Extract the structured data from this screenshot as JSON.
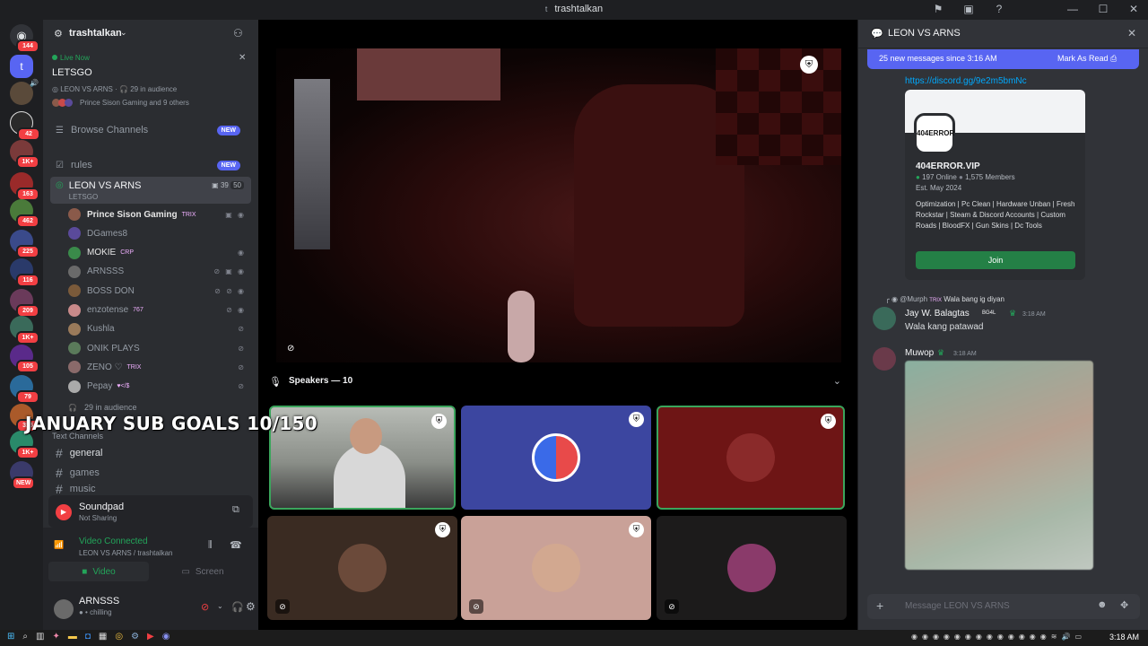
{
  "window": {
    "title": "trashtalkan",
    "title_icon": "t"
  },
  "server_rail": {
    "badges": [
      "144",
      "42",
      "1K+",
      "163",
      "462",
      "225",
      "116",
      "209",
      "1K+",
      "105",
      "79",
      "315",
      "1K+",
      "NEW"
    ]
  },
  "server": {
    "name": "trashtalkan",
    "live": {
      "status": "Live Now",
      "event_name": "LETSGO",
      "channel": "LEON VS ARNS",
      "audience": "29 in audience",
      "attendees": "Prince Sison Gaming and 9 others"
    },
    "browse_channels": "Browse Channels",
    "new_label": "NEW",
    "rules": "rules",
    "voice_channel": {
      "name": "LEON VS ARNS",
      "sub": "LETSGO",
      "count_a": "39",
      "count_b": "50"
    },
    "members": [
      {
        "name": "Prince Sison Gaming",
        "tag": "TRIX",
        "icons": "▣ ◉",
        "color": "#e6e6e6",
        "bold": true,
        "avatar": "#8a5a4a"
      },
      {
        "name": "DGames8",
        "tag": "",
        "icons": "",
        "color": "#949ba4",
        "bold": false,
        "avatar": "#5a4a9a"
      },
      {
        "name": "MOKIE",
        "tag": "CRP",
        "icons": "◉",
        "color": "#e6e6e6",
        "bold": false,
        "avatar": "#3a8a4a"
      },
      {
        "name": "ARNSSS",
        "tag": "",
        "icons": "⊘ ▣ ◉",
        "color": "#949ba4",
        "bold": false,
        "avatar": "#6a6a6a"
      },
      {
        "name": "BOSS DON",
        "tag": "",
        "icons": "⊘ ⊘ ◉",
        "color": "#949ba4",
        "bold": false,
        "avatar": "#7a5a3a"
      },
      {
        "name": "enzotense",
        "tag": "767",
        "icons": "⊘ ◉",
        "color": "#949ba4",
        "bold": false,
        "avatar": "#c98a8a"
      },
      {
        "name": "Kushla",
        "tag": "",
        "icons": "⊘",
        "color": "#949ba4",
        "bold": false,
        "avatar": "#9a7a5a"
      },
      {
        "name": "ONIK PLAYS",
        "tag": "",
        "icons": "⊘",
        "color": "#949ba4",
        "bold": false,
        "avatar": "#5a7a5a"
      },
      {
        "name": "ZENO ♡",
        "tag": "TRIX",
        "icons": "⊘",
        "color": "#949ba4",
        "bold": false,
        "avatar": "#8a6a6a"
      },
      {
        "name": "Pepay",
        "tag": "♥</$",
        "icons": "⊘",
        "color": "#949ba4",
        "bold": false,
        "avatar": "#aaaaaa"
      }
    ],
    "audience_row": "29 in audience",
    "text_channels_header": "Text Channels",
    "text_channels": [
      "general",
      "games",
      "music"
    ]
  },
  "overlay": {
    "sub_goal": "JANUARY SUB GOALS 10/150"
  },
  "soundpad": {
    "title": "Soundpad",
    "status": "Not Sharing"
  },
  "voice_status": {
    "status": "Video Connected",
    "location": "LEON VS ARNS / trashtalkan",
    "video_btn": "Video",
    "screen_btn": "Screen"
  },
  "user": {
    "name": "ARNSSS",
    "status": "chilling"
  },
  "stage": {
    "speakers_header": "Speakers — 10",
    "tiles": [
      {
        "kind": "camera",
        "bg": "#8b8f8a",
        "border": "#3ba55c",
        "shield": true,
        "muted": false
      },
      {
        "kind": "logo",
        "bg": "#3c46a0",
        "border": "none",
        "shield": true,
        "muted": false
      },
      {
        "kind": "avatar",
        "bg": "#6e1515",
        "border": "#3ba55c",
        "shield": true,
        "muted": false,
        "avatar": "#8a2a2a"
      },
      {
        "kind": "avatar",
        "bg": "#3a2b22",
        "border": "none",
        "shield": true,
        "muted": true,
        "avatar": "#6b4a3a"
      },
      {
        "kind": "avatar",
        "bg": "#c9a198",
        "border": "none",
        "shield": true,
        "muted": true,
        "avatar": "#d2a890"
      },
      {
        "kind": "avatar",
        "bg": "#1c1b1b",
        "border": "none",
        "shield": false,
        "muted": true,
        "avatar": "#8a3a6a"
      }
    ]
  },
  "chat": {
    "channel": "LEON VS ARNS",
    "new_messages": "25 new messages since 3:16 AM",
    "mark_as_read": "Mark As Read",
    "invite_link": "https://discord.gg/9e2m5bmNc",
    "invite": {
      "logo_text": "404ERROR",
      "server_name": "404ERROR.VIP",
      "online": "197 Online",
      "members": "1,575 Members",
      "established": "Est. May 2024",
      "description": "Optimization | Pc Clean | Hardware Unban | Fresh Rockstar | Steam & Discord Accounts | Custom Roads | BloodFX | Gun Skins | Dc Tools",
      "join": "Join"
    },
    "reply": {
      "to": "@Murph",
      "tag": "TRIX",
      "text": "Wala bang ig diyan"
    },
    "messages": [
      {
        "author": "Jay W. Balagtas",
        "tag": "BG4L",
        "time": "3:18 AM",
        "text": "Wala kang patawad"
      },
      {
        "author": "Muwop",
        "tag": "",
        "time": "3:18 AM",
        "text": ""
      }
    ],
    "input_placeholder": "Message LEON VS ARNS"
  },
  "taskbar": {
    "clock": "3:18 AM"
  }
}
